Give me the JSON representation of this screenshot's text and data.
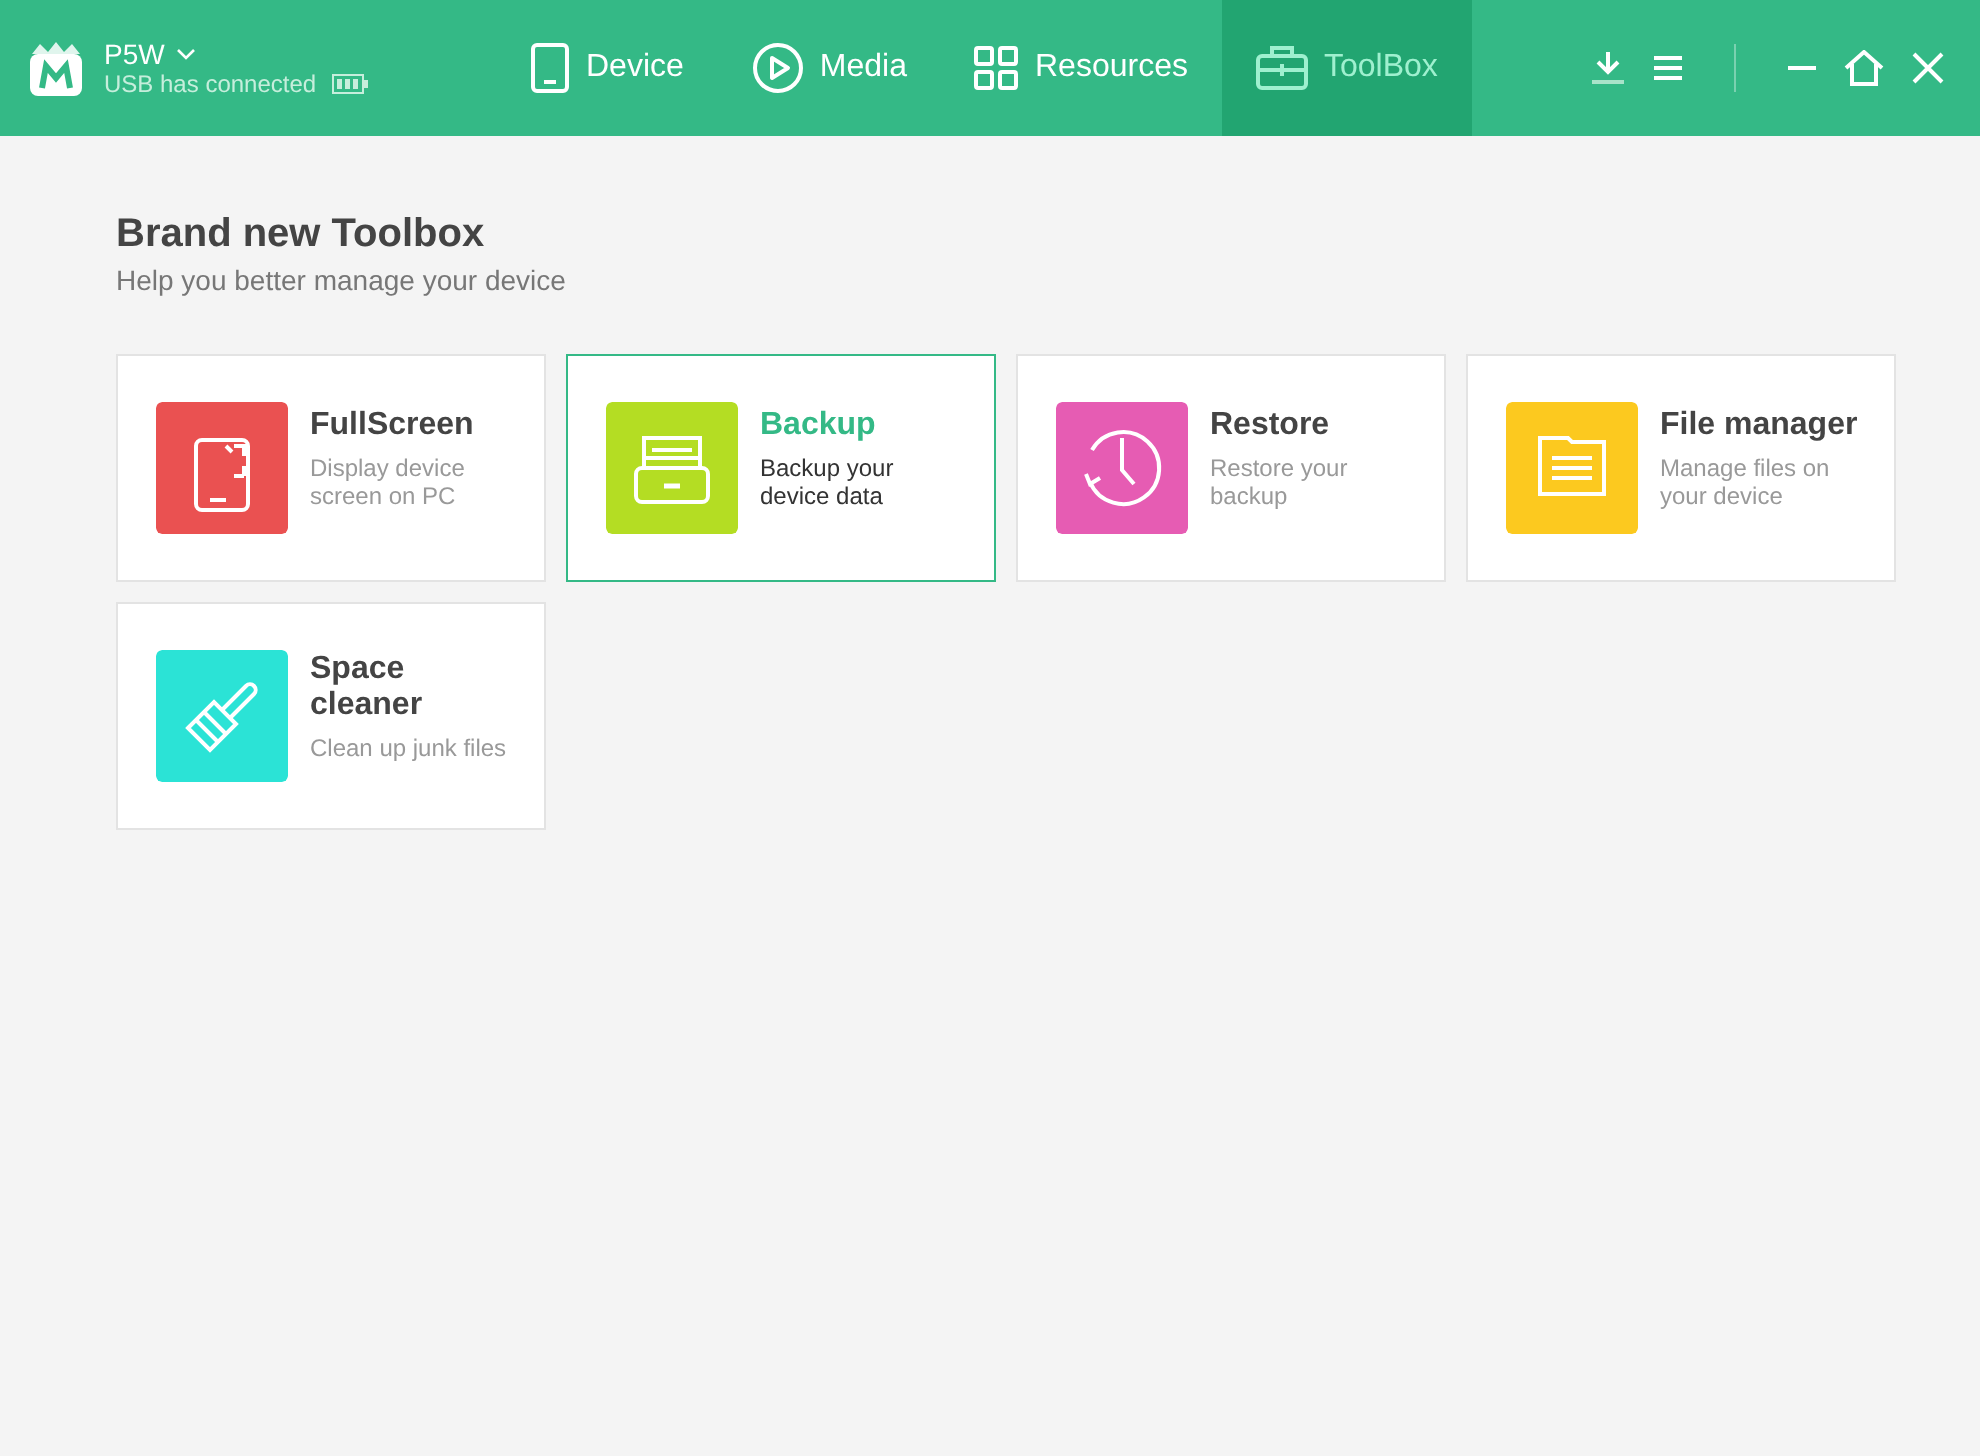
{
  "device": {
    "name": "P5W",
    "status": "USB has connected"
  },
  "tabs": [
    {
      "label": "Device",
      "kind": "device",
      "selected": false
    },
    {
      "label": "Media",
      "kind": "media",
      "selected": false
    },
    {
      "label": "Resources",
      "kind": "resources",
      "selected": false
    },
    {
      "label": "ToolBox",
      "kind": "toolbox",
      "selected": true
    }
  ],
  "heading": {
    "title": "Brand new Toolbox",
    "subtitle": "Help you better manage your device"
  },
  "tools": [
    {
      "title": "FullScreen",
      "description": "Display device screen on PC",
      "kind": "fullscreen",
      "color": "#ea5151",
      "hovered": false
    },
    {
      "title": "Backup",
      "description": "Backup your device data",
      "kind": "backup",
      "color": "#b4dd23",
      "hovered": true
    },
    {
      "title": "Restore",
      "description": "Restore your backup",
      "kind": "restore",
      "color": "#e65cb3",
      "hovered": false
    },
    {
      "title": "File manager",
      "description": "Manage files on your device",
      "kind": "files",
      "color": "#fcc91f",
      "hovered": false
    },
    {
      "title": "Space cleaner",
      "description": "Clean up junk files",
      "kind": "cleaner",
      "color": "#2be3d6",
      "hovered": false
    }
  ]
}
